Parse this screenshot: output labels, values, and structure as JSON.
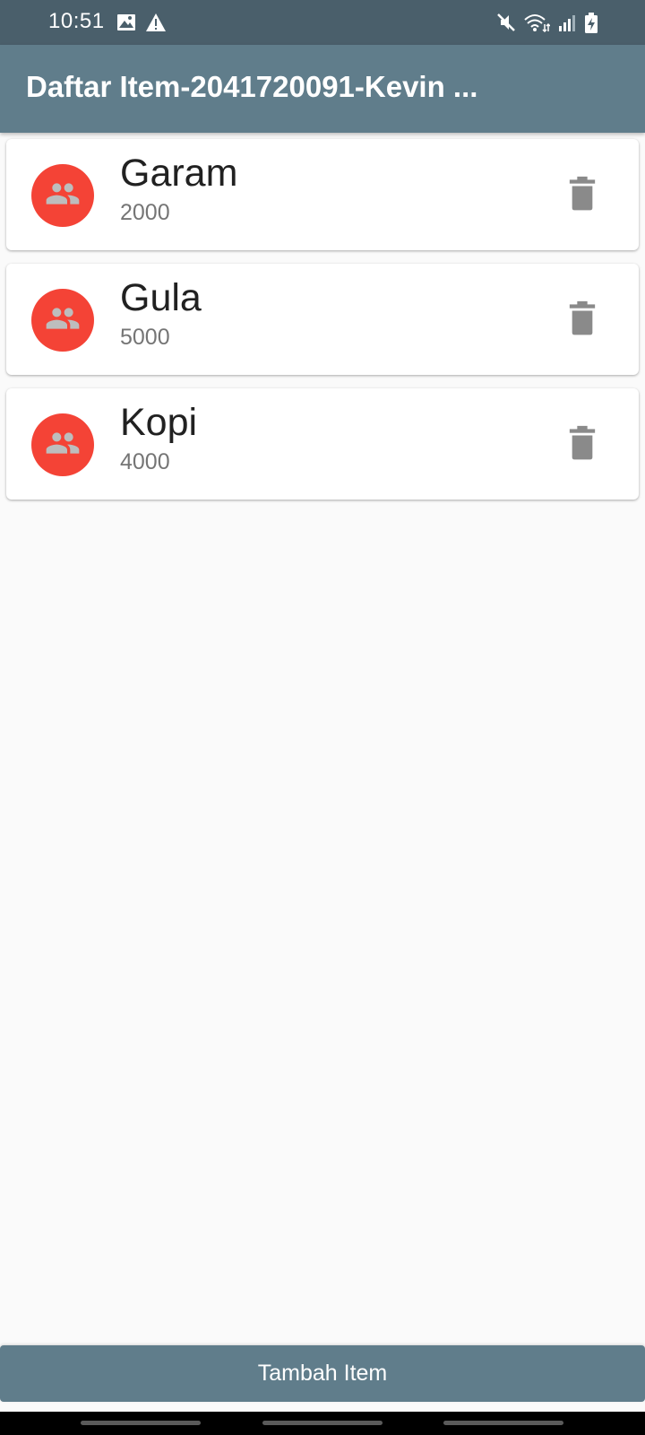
{
  "status_bar": {
    "time": "10:51",
    "left_icons": [
      "image-icon",
      "warning-icon"
    ],
    "right_icons": [
      "mute-icon",
      "wifi-icon",
      "signal-icon",
      "battery-charging-icon"
    ]
  },
  "app_bar": {
    "title": "Daftar Item-2041720091-Kevin ..."
  },
  "items": [
    {
      "name": "Garam",
      "price": "2000",
      "avatar_icon": "group-icon",
      "action_icon": "delete-icon"
    },
    {
      "name": "Gula",
      "price": "5000",
      "avatar_icon": "group-icon",
      "action_icon": "delete-icon"
    },
    {
      "name": "Kopi",
      "price": "4000",
      "avatar_icon": "group-icon",
      "action_icon": "delete-icon"
    }
  ],
  "add_button": {
    "label": "Tambah Item"
  },
  "colors": {
    "status_bar": "#4a5f6b",
    "app_bar": "#607d8b",
    "avatar": "#f44336",
    "avatar_icon": "#bdbdbd",
    "delete_icon": "#8a8a8a",
    "background": "#fafafa"
  }
}
